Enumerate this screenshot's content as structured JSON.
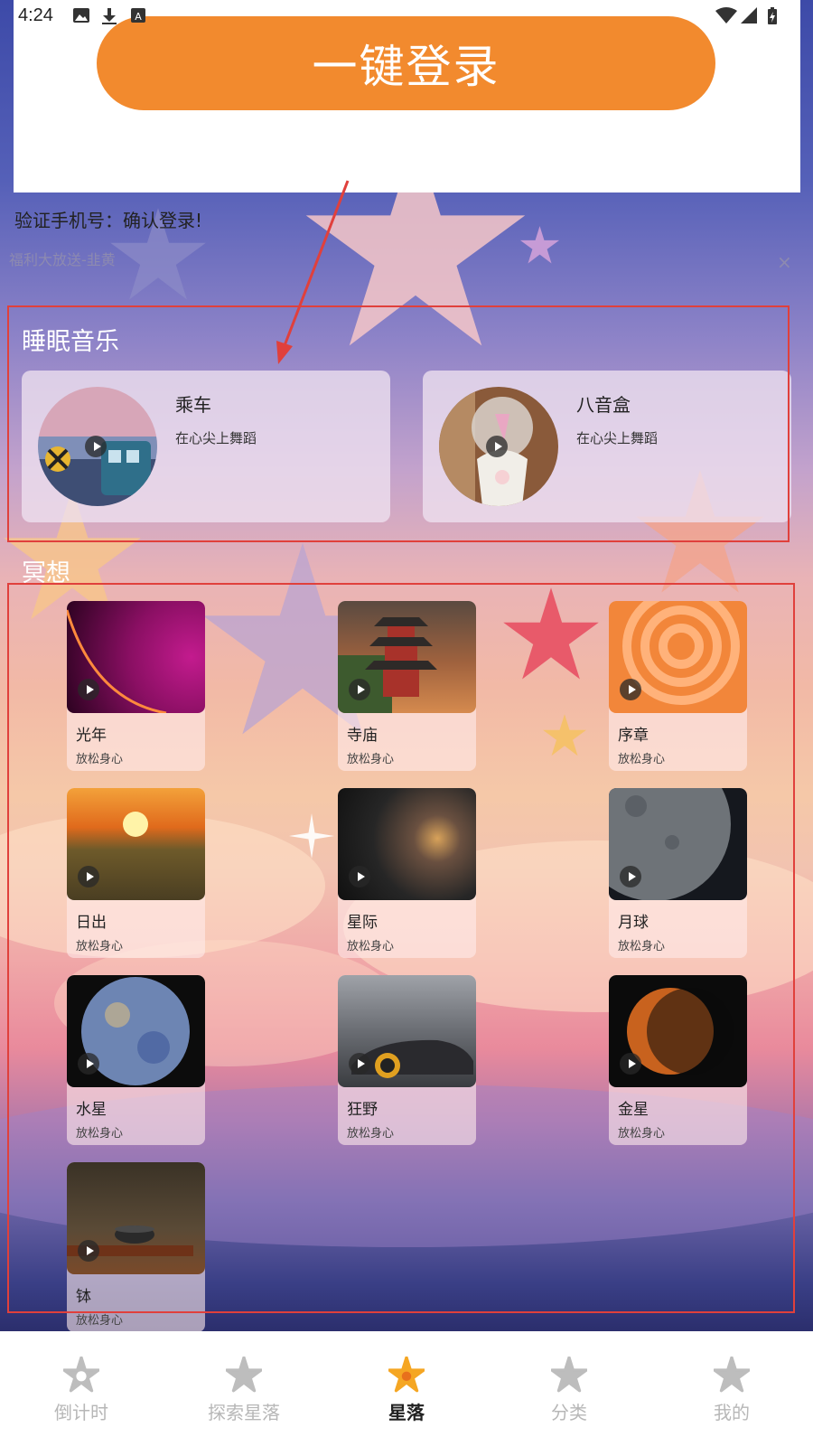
{
  "status_bar": {
    "time": "4:24",
    "icons": [
      "image-icon",
      "download-icon",
      "app-a-icon",
      "wifi-icon",
      "signal-icon",
      "battery-icon"
    ]
  },
  "login": {
    "button_label": "一键登录",
    "verify_text": "验证手机号：确认登录!",
    "promo_text": "福利大放送-韭黄",
    "promo_close": "×"
  },
  "sleep_music": {
    "title": "睡眠音乐",
    "items": [
      {
        "name": "乘车",
        "subtitle": "在心尖上舞蹈"
      },
      {
        "name": "八音盒",
        "subtitle": "在心尖上舞蹈"
      }
    ]
  },
  "meditation": {
    "title": "冥想",
    "items": [
      {
        "name": "光年",
        "subtitle": "放松身心"
      },
      {
        "name": "寺庙",
        "subtitle": "放松身心"
      },
      {
        "name": "序章",
        "subtitle": "放松身心"
      },
      {
        "name": "日出",
        "subtitle": "放松身心"
      },
      {
        "name": "星际",
        "subtitle": "放松身心"
      },
      {
        "name": "月球",
        "subtitle": "放松身心"
      },
      {
        "name": "水星",
        "subtitle": "放松身心"
      },
      {
        "name": "狂野",
        "subtitle": "放松身心"
      },
      {
        "name": "金星",
        "subtitle": "放松身心"
      },
      {
        "name": "钵",
        "subtitle": "放松身心"
      }
    ]
  },
  "tabbar": {
    "tabs": [
      {
        "label": "倒计时",
        "active": false
      },
      {
        "label": "探索星落",
        "active": false
      },
      {
        "label": "星落",
        "active": true
      },
      {
        "label": "分类",
        "active": false
      },
      {
        "label": "我的",
        "active": false
      }
    ]
  },
  "colors": {
    "accent": "#f28a2e",
    "annotation": "#e0403c",
    "tab_inactive": "#b7b7b7",
    "tab_active_icon": "#f5a623"
  }
}
